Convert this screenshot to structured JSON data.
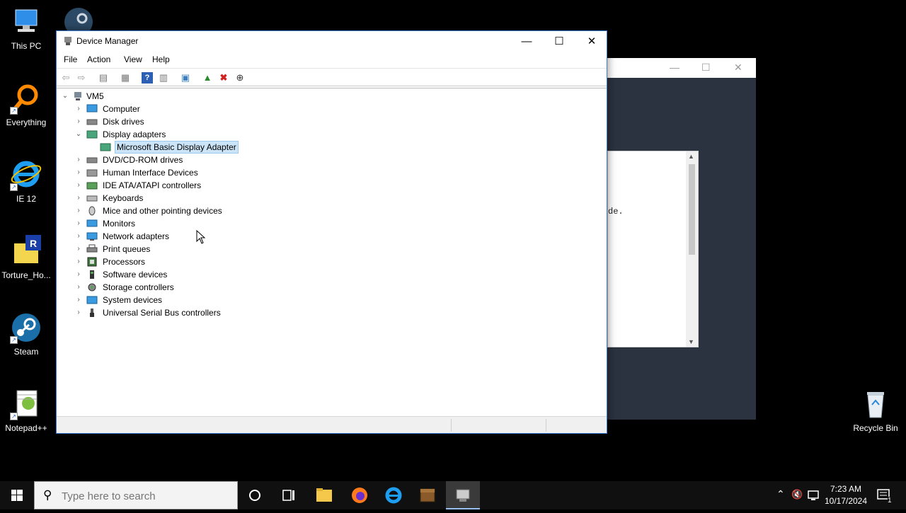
{
  "desktop": {
    "icons": [
      {
        "label": "This PC"
      },
      {
        "label": "Everything"
      },
      {
        "label": "IE 12"
      },
      {
        "label": "Torture_Ho..."
      },
      {
        "label": "Steam"
      },
      {
        "label": "Notepad++"
      },
      {
        "label": "Recycle Bin"
      }
    ]
  },
  "background_window": {
    "snippet": "de."
  },
  "device_manager": {
    "title": "Device Manager",
    "menu": [
      "File",
      "Action",
      "View",
      "Help"
    ],
    "tree": {
      "root": "VM5",
      "categories": [
        {
          "label": "Computer",
          "expanded": false
        },
        {
          "label": "Disk drives",
          "expanded": false
        },
        {
          "label": "Display adapters",
          "expanded": true,
          "children": [
            "Microsoft Basic Display Adapter"
          ]
        },
        {
          "label": "DVD/CD-ROM drives",
          "expanded": false
        },
        {
          "label": "Human Interface Devices",
          "expanded": false
        },
        {
          "label": "IDE ATA/ATAPI controllers",
          "expanded": false
        },
        {
          "label": "Keyboards",
          "expanded": false
        },
        {
          "label": "Mice and other pointing devices",
          "expanded": false
        },
        {
          "label": "Monitors",
          "expanded": false
        },
        {
          "label": "Network adapters",
          "expanded": false
        },
        {
          "label": "Print queues",
          "expanded": false
        },
        {
          "label": "Processors",
          "expanded": false
        },
        {
          "label": "Software devices",
          "expanded": false
        },
        {
          "label": "Storage controllers",
          "expanded": false
        },
        {
          "label": "System devices",
          "expanded": false
        },
        {
          "label": "Universal Serial Bus controllers",
          "expanded": false
        }
      ]
    }
  },
  "taskbar": {
    "search_placeholder": "Type here to search",
    "time": "7:23 AM",
    "date": "10/17/2024",
    "notification_count": "1"
  },
  "colors": {
    "selection": "#cce4f7",
    "window_border": "#3a7bd5",
    "taskbar": "#101010"
  }
}
